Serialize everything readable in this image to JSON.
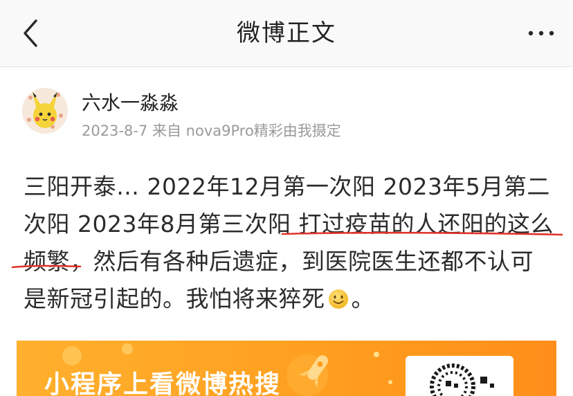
{
  "nav": {
    "title": "微博正文",
    "back_icon": "chevron-left-icon",
    "more_icon": "more-dots-icon"
  },
  "post": {
    "username": "六水一淼淼",
    "meta": "2023-8-7  来自 nova9Pro精彩由我摄定",
    "text_part1": "三阳开泰… 2022年12月第一次阳 2023年5月第二次阳 2023年8月第三次阳 打过疫苗的人还阳的这么频繁，然后有各种后遗症，到医院医生还都不认可是新冠引起的。我怕将来猝死",
    "text_part2": "。",
    "emoji": "smiley-icon"
  },
  "banner": {
    "text": "小程序上看微博热搜",
    "background_color": "#ffa726"
  },
  "colors": {
    "underline": "#e0322a",
    "meta_gray": "#9a9a9a"
  }
}
